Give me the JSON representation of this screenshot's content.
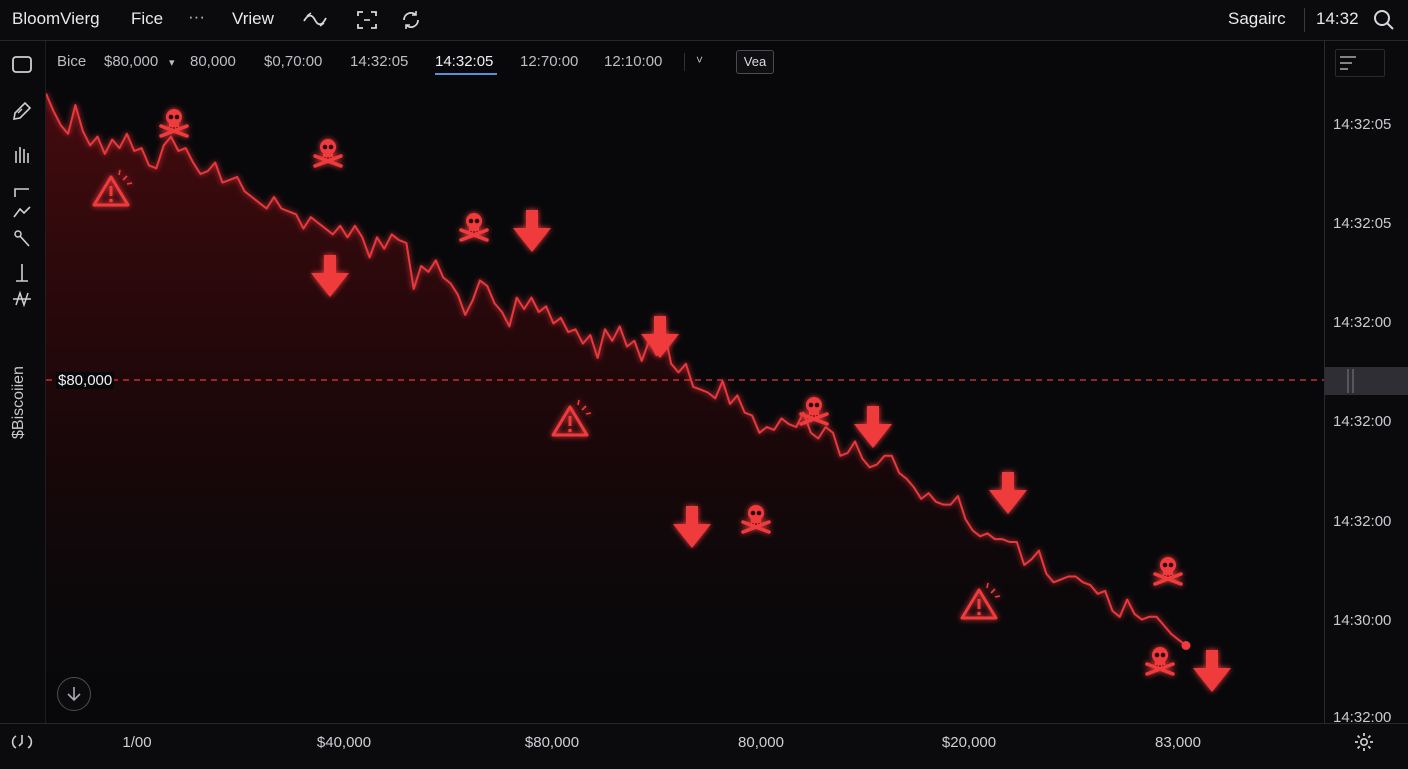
{
  "topbar": {
    "brand": "BloomVierg",
    "menu_file": "Fice",
    "menu_more": "···",
    "menu_view": "Vriew",
    "user": "Sagairc",
    "clock": "14:32"
  },
  "toolbar": {
    "items": [
      "Bice",
      "$80,000",
      "80,000",
      "$0,70:00",
      "14:32:05",
      "14:32:05",
      "12:70:00",
      "12:10:00"
    ],
    "dropdown_caret": "▾",
    "chevron": "˅",
    "volume_button": "Vea",
    "active_index": 5
  },
  "sidebar": {
    "vertical_label": "$Biscoiien"
  },
  "price_line": {
    "label": "$80,000"
  },
  "y_axis": {
    "ticks": [
      "14:32:05",
      "14:32:05",
      "14:32:00",
      "14:32:00",
      "14:32:00",
      "14:30:00",
      "14:32:00"
    ]
  },
  "x_axis": {
    "ticks": [
      "1/00",
      "$40,000",
      "$80,000",
      "80,000",
      "$20,000",
      "83,000"
    ]
  },
  "chart_data": {
    "type": "line",
    "series": [
      {
        "values": [
          96,
          90,
          85,
          82,
          92,
          83,
          78,
          81,
          75,
          80,
          77,
          82,
          76,
          77,
          71,
          70,
          78,
          81,
          76,
          77,
          72,
          68,
          69,
          72,
          65,
          66,
          67,
          62,
          60,
          58,
          56,
          60,
          56,
          55,
          54,
          49,
          53,
          51,
          49,
          47,
          50,
          46,
          50,
          46,
          39,
          46,
          42,
          47,
          45,
          44,
          28,
          36,
          34,
          38,
          32,
          30,
          26,
          19,
          24,
          31,
          29,
          23,
          20,
          15,
          25,
          21,
          25,
          20,
          22,
          16,
          18,
          13,
          14,
          9,
          12,
          4,
          14,
          10,
          15,
          8,
          10,
          3,
          10,
          5,
          14,
          2,
          -1,
          2,
          -6,
          -7,
          -8,
          -10,
          -4,
          -12,
          -9,
          -15,
          -16,
          -22,
          -20,
          -21,
          -17,
          -19,
          -20,
          -15,
          -22,
          -24,
          -20,
          -22,
          -30,
          -29,
          -25,
          -31,
          -34,
          -33,
          -30,
          -30,
          -36,
          -38,
          -41,
          -45,
          -43,
          -46,
          -47,
          -47,
          -44,
          -52,
          -56,
          -58,
          -57,
          -59,
          -59,
          -60,
          -60,
          -68,
          -66,
          -63,
          -71,
          -74,
          -73,
          -72,
          -72,
          -74,
          -75,
          -78,
          -77,
          -84,
          -86,
          -80,
          -85,
          -87,
          -86,
          -86,
          -89,
          -92,
          -94,
          -96
        ]
      }
    ],
    "reference_line": 80000,
    "markers": {
      "skulls": 8,
      "warnings": 3,
      "down_arrows": 8
    },
    "colors": {
      "line": "#e8383d",
      "marker": "#f03a3e",
      "fill": "#4a0a0d"
    }
  }
}
